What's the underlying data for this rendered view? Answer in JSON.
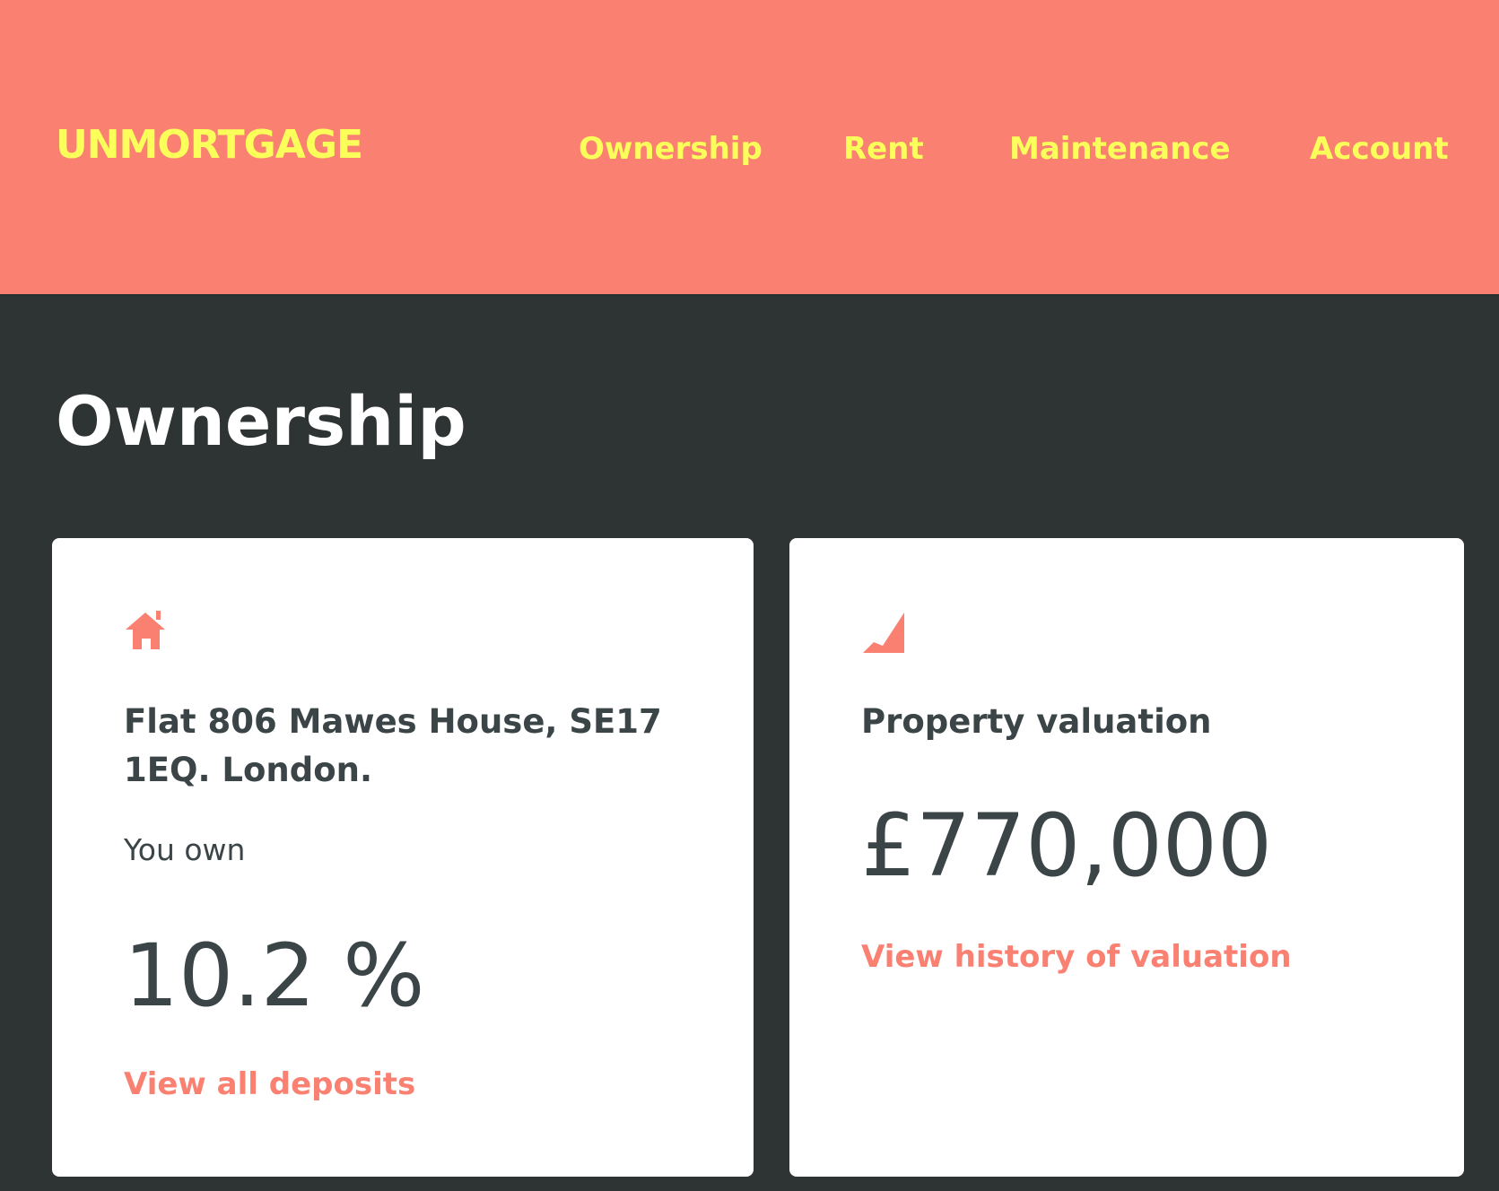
{
  "brand": {
    "logo_text": "UNMORTGAGE",
    "primary_color": "#fa8072",
    "accent_color": "#fbff5a",
    "background_color": "#2e3333",
    "text_color": "#3b4446"
  },
  "nav": {
    "items": [
      {
        "label": "Ownership"
      },
      {
        "label": "Rent"
      },
      {
        "label": "Maintenance"
      },
      {
        "label": "Account"
      }
    ]
  },
  "page": {
    "title": "Ownership"
  },
  "ownership_card": {
    "icon": "home-icon",
    "address": "Flat 806 Mawes House, SE17 1EQ. London.",
    "you_own_label": "You own",
    "ownership_percent": "10.2 %",
    "link_label": "View all deposits"
  },
  "valuation_card": {
    "icon": "chart-rising-icon",
    "title": "Property valuation",
    "value": "£770,000",
    "link_label": "View history of valuation"
  }
}
